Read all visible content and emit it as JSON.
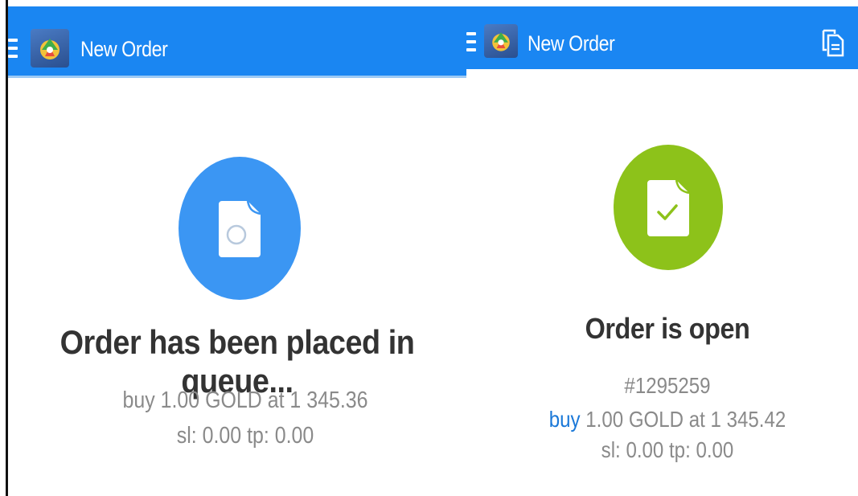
{
  "colors": {
    "appbar": "#1a86f2",
    "pending_circle": "#3b96f3",
    "open_circle": "#8dc21a",
    "buy_link": "#1a78d8",
    "heading_text": "#333333",
    "detail_text": "#8a8a8a"
  },
  "left_screen": {
    "appbar": {
      "menu_icon": "hamburger-icon",
      "logo_icon": "metatrader-logo-icon",
      "title": "New Order"
    },
    "status_icon": "document-pending-icon",
    "heading": "Order has been placed in queue...",
    "details": {
      "line1": "buy 1.00 GOLD at 1 345.36",
      "line2": "sl: 0.00 tp: 0.00"
    }
  },
  "right_screen": {
    "appbar": {
      "menu_icon": "hamburger-icon",
      "logo_icon": "metatrader-logo-icon",
      "title": "New Order",
      "action_icon": "copy-document-icon"
    },
    "status_icon": "document-check-icon",
    "heading": "Order is open",
    "details": {
      "ticket": "#1295259",
      "side": "buy",
      "line1_rest": " 1.00 GOLD at 1 345.42",
      "line2": "sl: 0.00 tp: 0.00"
    }
  }
}
